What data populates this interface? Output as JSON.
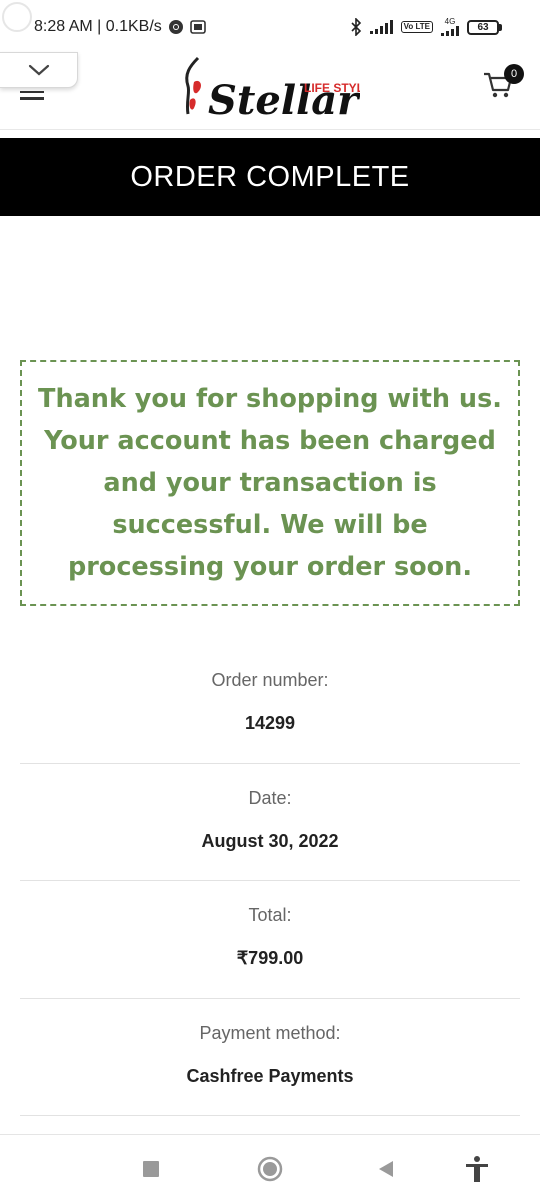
{
  "status_bar": {
    "time_network": "8:28 AM | 0.1KB/s",
    "volte_tag": "Vo LTE",
    "network_tag": "4G",
    "battery": "63",
    "icons": [
      "chrome-icon",
      "sim-icon",
      "bluetooth-icon",
      "signal-icon",
      "volte-icon",
      "battery-icon"
    ]
  },
  "header": {
    "logo_text": "Stellar",
    "logo_tagline": "LIFE STYL",
    "cart_count": "0"
  },
  "banner": {
    "title": "ORDER COMPLETE"
  },
  "thanks": {
    "message": "Thank you for shopping with us. Your account has been charged and your transaction is successful. We will be processing your order soon."
  },
  "order_details": [
    {
      "label": "Order number:",
      "value": "14299"
    },
    {
      "label": "Date:",
      "value": "August 30, 2022"
    },
    {
      "label": "Total:",
      "value": "₹799.00"
    },
    {
      "label": "Payment method:",
      "value": "Cashfree Payments"
    }
  ],
  "colors": {
    "accent_green": "#6b9352",
    "banner_bg": "#000000",
    "logo_red": "#d62b2b"
  }
}
